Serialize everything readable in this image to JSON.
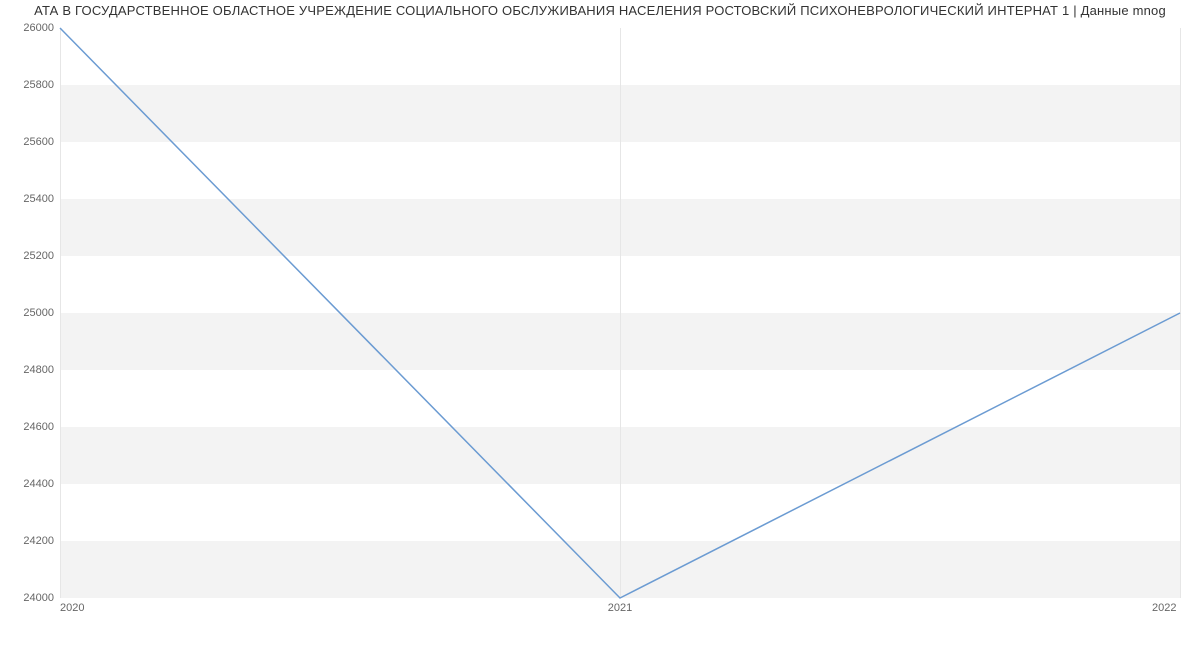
{
  "chart_data": {
    "type": "line",
    "title": "АТА В ГОСУДАРСТВЕННОЕ ОБЛАСТНОЕ УЧРЕЖДЕНИЕ СОЦИАЛЬНОГО ОБСЛУЖИВАНИЯ НАСЕЛЕНИЯ РОСТОВСКИЙ ПСИХОНЕВРОЛОГИЧЕСКИЙ ИНТЕРНАТ 1 | Данные mnog",
    "x": [
      2020,
      2021,
      2022
    ],
    "values": [
      26000,
      24000,
      25000
    ],
    "xlabel": "",
    "ylabel": "",
    "xlim": [
      2020,
      2022
    ],
    "ylim": [
      24000,
      26000
    ],
    "xticks": [
      2020,
      2021,
      2022
    ],
    "yticks": [
      24000,
      24200,
      24400,
      24600,
      24800,
      25000,
      25200,
      25400,
      25600,
      25800,
      26000
    ],
    "line_color": "#6b9bd2"
  }
}
